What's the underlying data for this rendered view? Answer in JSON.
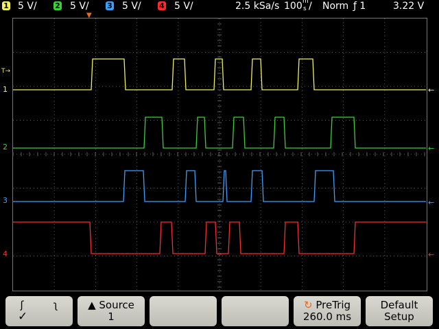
{
  "channels": [
    {
      "num": "1",
      "scale": "5 V/",
      "color": "#f1f15c"
    },
    {
      "num": "2",
      "scale": "5 V/",
      "color": "#39d13a"
    },
    {
      "num": "3",
      "scale": "5 V/",
      "color": "#3aa0ff"
    },
    {
      "num": "4",
      "scale": "5 V/",
      "color": "#ff2a2a"
    }
  ],
  "acquisition": {
    "sample_rate": "2.5 kSa/s",
    "timebase": "100",
    "timebase_unit_top": "m",
    "timebase_unit_bottom": "s",
    "divider": "/"
  },
  "trigger": {
    "mode": "Norm",
    "source_symbol": "ƒ 1",
    "level": "3.22 V",
    "position_marker": "▼"
  },
  "markers": {
    "trig_level": "T→",
    "ch_labels": [
      "1",
      "2",
      "3",
      "4"
    ],
    "right_arrow": "←"
  },
  "softkeys": {
    "slope": {
      "rise": "ʃ",
      "fall": "ʅ",
      "check": "✓"
    },
    "source": {
      "label": "▲ Source",
      "value": "1"
    },
    "pretrig": {
      "label": "PreTrig",
      "value": "260.0 ms",
      "icon": "↻"
    },
    "default": {
      "label": "Default",
      "value": "Setup"
    }
  },
  "colors": {
    "grid": "#5a5a5a",
    "softkey_bg": "#cfcfc8",
    "accent_orange": "#e86a1a"
  }
}
